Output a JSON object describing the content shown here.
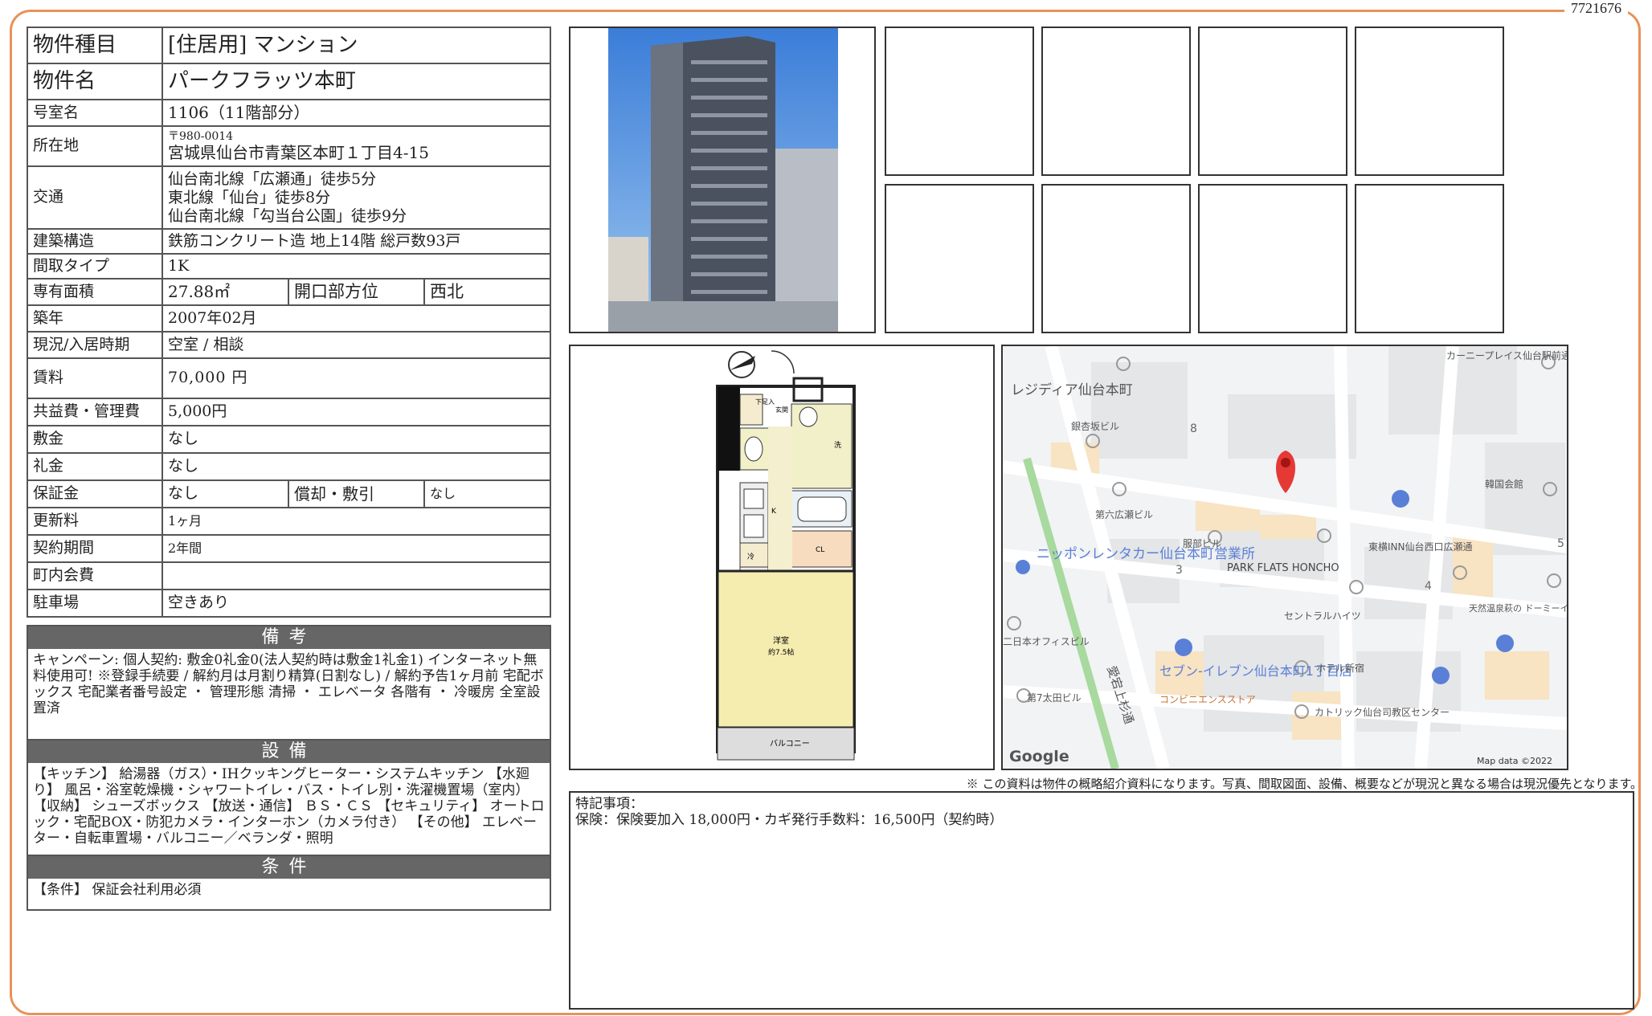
{
  "doc_id": "7721676",
  "property": {
    "type_label": "物件種目",
    "type_value": "[住居用] マンション",
    "name_label": "物件名",
    "name_value": "パークフラッツ本町",
    "room_label": "号室名",
    "room_value": "1106（11階部分）",
    "address_label": "所在地",
    "postal": "〒980-0014",
    "address": "宮城県仙台市青葉区本町１丁目4-15",
    "transit_label": "交通",
    "transit": [
      "仙台南北線「広瀬通」徒歩5分",
      "東北線「仙台」徒歩8分",
      "仙台南北線「勾当台公園」徒歩9分"
    ],
    "structure_label": "建築構造",
    "structure_value": "鉄筋コンクリート造 地上14階 総戸数93戸",
    "layout_label": "間取タイプ",
    "layout_value": "1K",
    "area_label": "専有面積",
    "area_value": "27.88㎡",
    "direction_label": "開口部方位",
    "direction_value": "西北",
    "built_label": "築年",
    "built_value": "2007年02月",
    "status_label": "現況/入居時期",
    "status_value": "空室 / 相談",
    "rent_label": "賃料",
    "rent_value": "70,000 円",
    "fee_label": "共益費・管理費",
    "fee_value": "5,000円",
    "deposit_label": "敷金",
    "deposit_value": "なし",
    "key_money_label": "礼金",
    "key_money_value": "なし",
    "guarantee_label": "保証金",
    "guarantee_value": "なし",
    "amort_label": "償却・敷引",
    "amort_value": "なし",
    "renewal_label": "更新料",
    "renewal_value": "1ヶ月",
    "contract_label": "契約期間",
    "contract_value": "2年間",
    "community_label": "町内会費",
    "community_value": "",
    "parking_label": "駐車場",
    "parking_value": "空きあり"
  },
  "remarks": {
    "title": "備考",
    "text": "キャンペーン: 個人契約: 敷金0礼金0(法人契約時は敷金1礼金1) インターネット無料使用可! ※登録手続要 / 解約月は月割り精算(日割なし) / 解約予告1ヶ月前 宅配ボックス 宅配業者番号設定 ・ 管理形態 清掃 ・ エレベータ 各階有 ・ 冷暖房 全室設置済"
  },
  "equipment": {
    "title": "設備",
    "text": "【キッチン】 給湯器（ガス）・IHクッキングヒーター・システムキッチン 【水廻り】 風呂・浴室乾燥機・シャワートイレ・バス・トイレ別・洗濯機置場（室内） 【収納】 シューズボックス 【放送・通信】 ＢＳ・ＣＳ 【セキュリティ】 オートロック・宅配BOX・防犯カメラ・インターホン（カメラ付き） 【その他】 エレベーター・自転車置場・バルコニー／ベランダ・照明"
  },
  "conditions": {
    "title": "条件",
    "text": "【条件】 保証会社利用必須"
  },
  "floorplan": {
    "labels": {
      "entrance": "玄関",
      "shoe": "下足入",
      "wash": "洗",
      "kitchen": "K",
      "fridge": "冷",
      "closet": "CL",
      "room": "洋室",
      "room_size": "約7.5帖",
      "balcony": "バルコニー"
    }
  },
  "map": {
    "labels": [
      "レジディア仙台本町",
      "銀杏坂ビル",
      "第六広瀬ビル",
      "服部ビル",
      "PARK FLATS HONCHO",
      "東横INN仙台西口広瀬通",
      "カーニープレイス仙台駅前通ビル",
      "韓国会館",
      "ニッポンレンタカー仙台本町営業所",
      "セントラルハイツ",
      "天然温泉萩の ドーミーイン仙台駅",
      "二日本オフィスビル",
      "セブン-イレブン仙台本町1丁目店",
      "コンビニエンスストア",
      "ホテル新宿",
      "第7太田ビル",
      "カトリック仙台司教区センター",
      "愛宕上杉通",
      "8",
      "3",
      "4",
      "5"
    ],
    "brand": "Google",
    "attribution": "Map data ©2022"
  },
  "disclaimer": "※ この資料は物件の概略紹介資料になります。写真、間取図面、設備、概要などが現況と異なる場合は現況優先となります。",
  "special": {
    "title": "特記事項：",
    "text": "保険：保険要加入 18,000円・カギ発行手数料：16,500円（契約時）"
  },
  "colors": {
    "frame": "#e8925a",
    "header_bar": "#666666",
    "map_pin": "#e53935",
    "map_poi": "#5a7fd6"
  }
}
